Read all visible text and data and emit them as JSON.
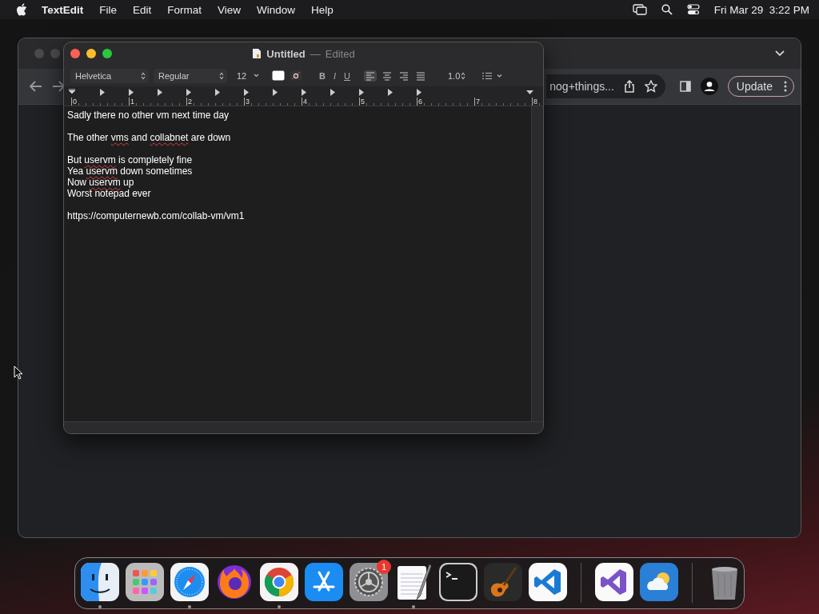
{
  "menu_bar": {
    "app": "TextEdit",
    "items": [
      "File",
      "Edit",
      "Format",
      "View",
      "Window",
      "Help"
    ],
    "date": "Fri Mar 29",
    "time": "3:22 PM"
  },
  "browser_window": {
    "address_text": "nog+things...",
    "update_button": "Update"
  },
  "textedit_window": {
    "title": "Untitled",
    "separator": "—",
    "status": "Edited",
    "toolbar": {
      "font": "Helvetica",
      "style": "Regular",
      "size": "12",
      "bold": "B",
      "italic": "I",
      "underline": "U",
      "spacing": "1.0"
    },
    "ruler": [
      "0",
      "1",
      "2",
      "3",
      "4",
      "5",
      "6",
      "7",
      "8"
    ],
    "paragraphs": [
      {
        "lines": [
          [
            {
              "text": "Sadly there no other vm next time day",
              "misspelled": false
            }
          ]
        ]
      },
      {
        "lines": [
          [
            {
              "text": "The other ",
              "misspelled": false
            },
            {
              "text": "vms",
              "misspelled": true
            },
            {
              "text": " and ",
              "misspelled": false
            },
            {
              "text": "collabnet",
              "misspelled": true
            },
            {
              "text": " are down",
              "misspelled": false
            }
          ]
        ]
      },
      {
        "lines": [
          [
            {
              "text": "But ",
              "misspelled": false
            },
            {
              "text": "uservm",
              "misspelled": true
            },
            {
              "text": " is completely fine",
              "misspelled": false
            }
          ],
          [
            {
              "text": "Yea ",
              "misspelled": false
            },
            {
              "text": "uservm",
              "misspelled": true
            },
            {
              "text": " down sometimes",
              "misspelled": false
            }
          ],
          [
            {
              "text": "Now ",
              "misspelled": false
            },
            {
              "text": "uservm",
              "misspelled": true
            },
            {
              "text": " up",
              "misspelled": false
            }
          ],
          [
            {
              "text": "Worst notepad ever",
              "misspelled": false
            }
          ]
        ]
      },
      {
        "lines": [
          [
            {
              "text": "https://computernewb.com/collab-vm/vm1",
              "misspelled": false
            }
          ]
        ]
      }
    ]
  },
  "dock": {
    "items": [
      {
        "kind": "finder",
        "running": true
      },
      {
        "kind": "launchpad",
        "running": false
      },
      {
        "kind": "safari",
        "running": true
      },
      {
        "kind": "firefox",
        "running": false
      },
      {
        "kind": "chrome",
        "running": true
      },
      {
        "kind": "appstore",
        "running": false
      },
      {
        "kind": "settings",
        "running": false,
        "badge": "1"
      },
      {
        "kind": "textedit",
        "running": true
      },
      {
        "kind": "terminal",
        "running": false
      },
      {
        "kind": "guitar",
        "running": false
      },
      {
        "kind": "vscode",
        "running": false
      },
      {
        "kind": "separator"
      },
      {
        "kind": "visualstudio",
        "running": false
      },
      {
        "kind": "weather",
        "running": false
      },
      {
        "kind": "separator"
      },
      {
        "kind": "trash",
        "running": false
      }
    ]
  }
}
